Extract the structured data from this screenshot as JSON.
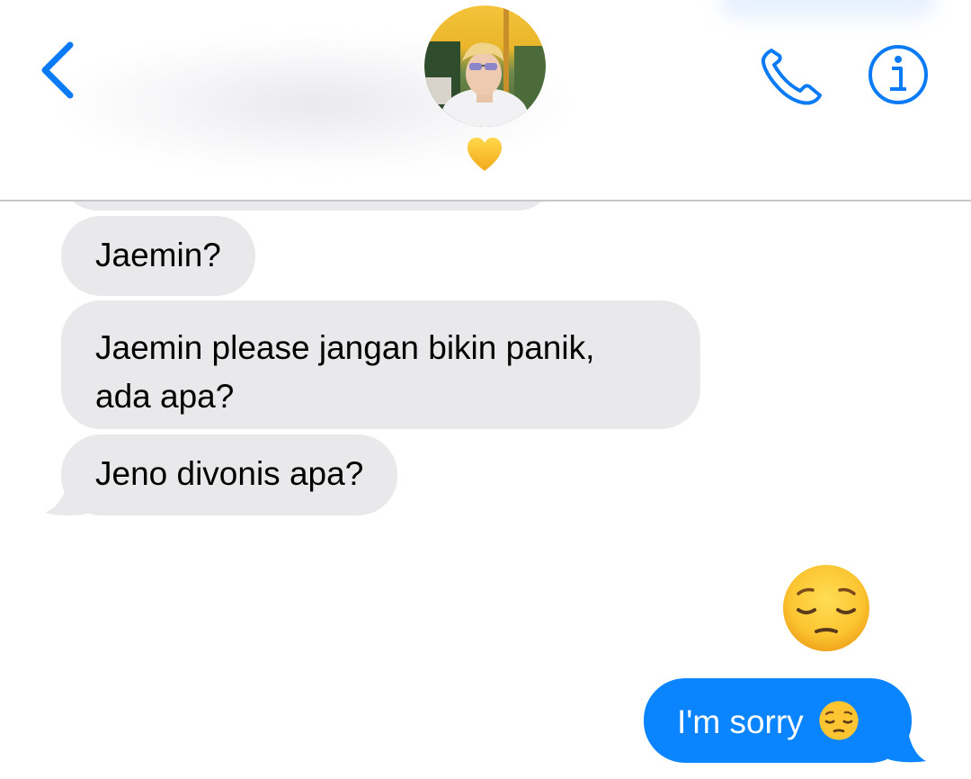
{
  "header": {
    "back_icon": "chevron-left-icon",
    "contact_status_emoji": "yellow-heart-icon",
    "call_icon": "phone-icon",
    "info_icon": "info-icon",
    "accent_color": "#0b84ff"
  },
  "messages": [
    {
      "direction": "incoming",
      "text": "Jaemin?"
    },
    {
      "direction": "incoming",
      "text": "Jaemin please jangan bikin panik,\nada apa?"
    },
    {
      "direction": "incoming",
      "text": "Jeno divonis apa?"
    },
    {
      "direction": "outgoing",
      "emoji_only": true,
      "emoji": "pensive-face-icon"
    },
    {
      "direction": "outgoing",
      "text": "I'm sorry",
      "emoji": "pensive-face-icon"
    }
  ],
  "colors": {
    "incoming_bubble": "#e9e9eb",
    "outgoing_bubble": "#0b84ff"
  }
}
